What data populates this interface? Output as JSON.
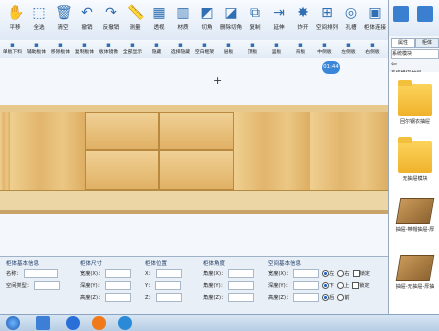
{
  "toolbar_main": [
    {
      "label": "平移",
      "icon": "hand-icon"
    },
    {
      "label": "全选",
      "icon": "select-all-icon"
    },
    {
      "label": "清空",
      "icon": "trash-icon"
    },
    {
      "label": "撤销",
      "icon": "undo-icon"
    },
    {
      "label": "反撤销",
      "icon": "redo-icon"
    },
    {
      "label": "测量",
      "icon": "measure-icon"
    },
    {
      "label": "透视",
      "icon": "perspective-icon"
    },
    {
      "label": "材质",
      "icon": "material-icon"
    },
    {
      "label": "切角",
      "icon": "chamfer-icon"
    },
    {
      "label": "删除切角",
      "icon": "delete-chamfer-icon"
    },
    {
      "label": "复制",
      "icon": "copy-icon"
    },
    {
      "label": "延伸",
      "icon": "extend-icon"
    },
    {
      "label": "炸开",
      "icon": "explode-icon"
    },
    {
      "label": "空间排列",
      "icon": "space-arrange-icon"
    },
    {
      "label": "孔槽",
      "icon": "hole-slot-icon"
    },
    {
      "label": "柜体连接",
      "icon": "cabinet-connect-icon"
    }
  ],
  "toolbar_sub": [
    {
      "label": "单板下料",
      "icon": "panel-cut-icon"
    },
    {
      "label": "辅助板体",
      "icon": "aux-panel-icon"
    },
    {
      "label": "移除板体",
      "icon": "remove-panel-icon"
    },
    {
      "label": "复制板体",
      "icon": "copy-panel-icon"
    },
    {
      "label": "板体镜像",
      "icon": "mirror-panel-icon"
    },
    {
      "label": "全部显示",
      "icon": "show-all-icon"
    },
    {
      "label": "隐藏",
      "icon": "hide-icon"
    },
    {
      "label": "选择隐藏",
      "icon": "select-hide-icon"
    },
    {
      "label": "空白框架",
      "icon": "blank-frame-icon"
    },
    {
      "label": "层板",
      "icon": "shelf-icon"
    },
    {
      "label": "顶板",
      "icon": "top-panel-icon"
    },
    {
      "label": "竖板",
      "icon": "vertical-panel-icon"
    },
    {
      "label": "背板",
      "icon": "back-panel-icon"
    },
    {
      "label": "中侧板",
      "icon": "mid-side-panel-icon"
    },
    {
      "label": "左侧板",
      "icon": "left-side-panel-icon"
    },
    {
      "label": "右侧板",
      "icon": "right-side-panel-icon"
    }
  ],
  "viewport": {
    "fps": "01:44"
  },
  "props": {
    "basic": {
      "title": "柜体基本信息",
      "name_label": "名称：",
      "space_label": "空间类型："
    },
    "size": {
      "title": "柜体尺寸",
      "w": "宽度(X)：",
      "d": "深度(Y)：",
      "h": "高度(Z)："
    },
    "pos": {
      "title": "柜体位置",
      "x": "X：",
      "y": "Y：",
      "z": "Z："
    },
    "angle": {
      "title": "柜体角度",
      "x": "角度(X)：",
      "y": "角度(Y)：",
      "z": "角度(Z)："
    },
    "space": {
      "title": "空间基本信息",
      "w": "宽度(X)：",
      "d": "深度(Y)：",
      "h": "高度(Z)：",
      "left": "左",
      "right": "右",
      "front": "前",
      "back": "后",
      "up": "上",
      "down": "下",
      "lock": "锁定"
    }
  },
  "right_panel": {
    "tabs": [
      "属性",
      "柜体"
    ],
    "search_placeholder": "系统模块",
    "path": "系统模块\\抽屉",
    "items": [
      {
        "label": "回尔钢衣抽屉",
        "kind": "folder"
      },
      {
        "label": "无抽屉模块",
        "kind": "folder"
      },
      {
        "label": "抽屉-带帽抽屉-厚",
        "kind": "drawer"
      },
      {
        "label": "抽屉-无抽屉-厚抽",
        "kind": "drawer"
      }
    ]
  },
  "colors": {
    "accent": "#2f6fb2",
    "wood": "#e6c180",
    "fps_badge": "#3a86d8"
  }
}
